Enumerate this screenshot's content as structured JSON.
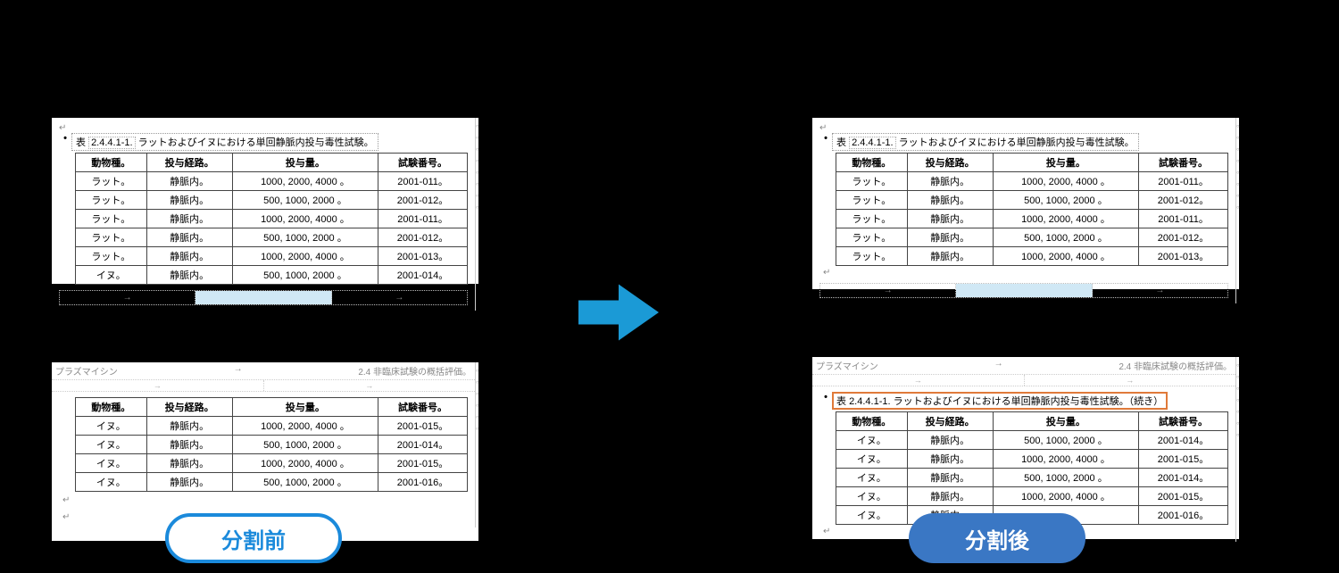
{
  "badges": {
    "before": "分割前",
    "after": "分割後"
  },
  "captions": {
    "main_num": "2.4.4.1-1.",
    "main_prefix": "表 ",
    "main_text": "ラットおよびイヌにおける単回静脈内投与毒性試験。",
    "cont_suffix": "（続き）"
  },
  "headers": {
    "col1": "動物種。",
    "col2": "投与経路。",
    "col3": "投与量。",
    "col4": "試験番号。"
  },
  "page_header": {
    "left": "プラズマイシン",
    "right": "2.4 非臨床試験の概括評価。"
  },
  "left_top_rows": [
    {
      "c1": "ラット。",
      "c2": "静脈内。",
      "c3": "1000, 2000, 4000 。",
      "c4": "2001-011。"
    },
    {
      "c1": "ラット。",
      "c2": "静脈内。",
      "c3": "500, 1000, 2000 。",
      "c4": "2001-012。"
    },
    {
      "c1": "ラット。",
      "c2": "静脈内。",
      "c3": "1000, 2000, 4000 。",
      "c4": "2001-011。"
    },
    {
      "c1": "ラット。",
      "c2": "静脈内。",
      "c3": "500, 1000, 2000 。",
      "c4": "2001-012。"
    },
    {
      "c1": "ラット。",
      "c2": "静脈内。",
      "c3": "1000, 2000, 4000 。",
      "c4": "2001-013。"
    },
    {
      "c1": "イヌ。",
      "c2": "静脈内。",
      "c3": "500, 1000, 2000 。",
      "c4": "2001-014。"
    }
  ],
  "left_bottom_rows": [
    {
      "c1": "イヌ。",
      "c2": "静脈内。",
      "c3": "1000, 2000, 4000 。",
      "c4": "2001-015。"
    },
    {
      "c1": "イヌ。",
      "c2": "静脈内。",
      "c3": "500, 1000, 2000 。",
      "c4": "2001-014。"
    },
    {
      "c1": "イヌ。",
      "c2": "静脈内。",
      "c3": "1000, 2000, 4000 。",
      "c4": "2001-015。"
    },
    {
      "c1": "イヌ。",
      "c2": "静脈内。",
      "c3": "500, 1000, 2000 。",
      "c4": "2001-016。"
    }
  ],
  "right_top_rows": [
    {
      "c1": "ラット。",
      "c2": "静脈内。",
      "c3": "1000, 2000, 4000 。",
      "c4": "2001-011。"
    },
    {
      "c1": "ラット。",
      "c2": "静脈内。",
      "c3": "500, 1000, 2000 。",
      "c4": "2001-012。"
    },
    {
      "c1": "ラット。",
      "c2": "静脈内。",
      "c3": "1000, 2000, 4000 。",
      "c4": "2001-011。"
    },
    {
      "c1": "ラット。",
      "c2": "静脈内。",
      "c3": "500, 1000, 2000 。",
      "c4": "2001-012。"
    },
    {
      "c1": "ラット。",
      "c2": "静脈内。",
      "c3": "1000, 2000, 4000 。",
      "c4": "2001-013。"
    }
  ],
  "right_bottom_rows": [
    {
      "c1": "イヌ。",
      "c2": "静脈内。",
      "c3": "500, 1000, 2000 。",
      "c4": "2001-014。"
    },
    {
      "c1": "イヌ。",
      "c2": "静脈内。",
      "c3": "1000, 2000, 4000 。",
      "c4": "2001-015。"
    },
    {
      "c1": "イヌ。",
      "c2": "静脈内。",
      "c3": "500, 1000, 2000 。",
      "c4": "2001-014。"
    },
    {
      "c1": "イヌ。",
      "c2": "静脈内。",
      "c3": "1000, 2000, 4000 。",
      "c4": "2001-015。"
    },
    {
      "c1": "イヌ。",
      "c2": "静脈内。",
      "c3": "",
      "c4": "2001-016。"
    }
  ],
  "marks": {
    "arrow": "→",
    "para": "↵"
  }
}
